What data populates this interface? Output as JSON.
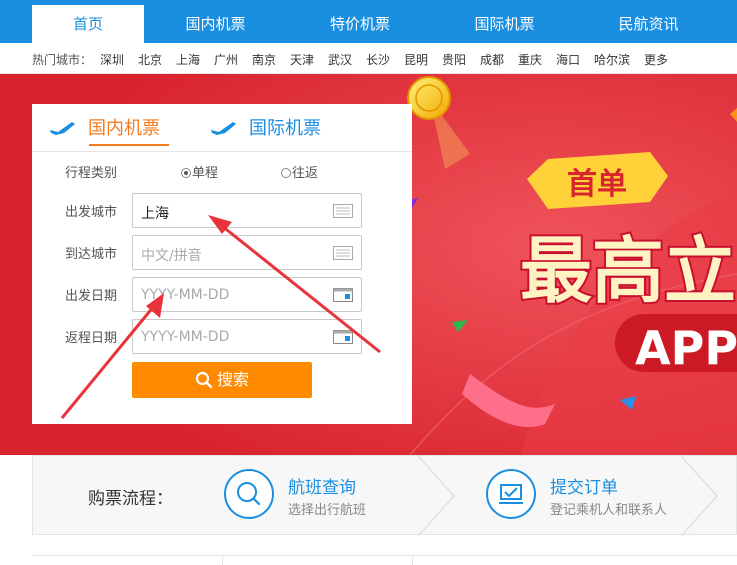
{
  "nav": {
    "items": [
      {
        "label": "首页"
      },
      {
        "label": "国内机票"
      },
      {
        "label": "特价机票"
      },
      {
        "label": "国际机票"
      },
      {
        "label": "民航资讯"
      }
    ]
  },
  "hot_cities": {
    "label": "热门城市：",
    "cities": [
      "深圳",
      "北京",
      "上海",
      "广州",
      "南京",
      "天津",
      "武汉",
      "长沙",
      "昆明",
      "贵阳",
      "成都",
      "重庆",
      "海口",
      "哈尔滨",
      "更多"
    ]
  },
  "banner": {
    "badge": "首单",
    "headline": "最高立",
    "app_text": "APP"
  },
  "search": {
    "tabs": [
      {
        "label": "国内机票"
      },
      {
        "label": "国际机票"
      }
    ],
    "trip_type_label": "行程类别",
    "one_way": "单程",
    "round_trip": "往返",
    "depart_city_label": "出发城市",
    "depart_city_value": "上海",
    "arrive_city_label": "到达城市",
    "arrive_city_placeholder": "中文/拼音",
    "depart_date_label": "出发日期",
    "depart_date_placeholder": "YYYY-MM-DD",
    "return_date_label": "返程日期",
    "return_date_placeholder": "YYYY-MM-DD",
    "search_button": "搜索"
  },
  "process": {
    "title": "购票流程：",
    "steps": [
      {
        "title": "航班查询",
        "subtitle": "选择出行航班",
        "icon": "search-icon"
      },
      {
        "title": "提交订单",
        "subtitle": "登记乘机人和联系人",
        "icon": "order-icon"
      }
    ]
  },
  "colors": {
    "primary": "#1a8ee0",
    "accent": "#f47c20",
    "banner": "#e73240",
    "button": "#ff8a00"
  }
}
